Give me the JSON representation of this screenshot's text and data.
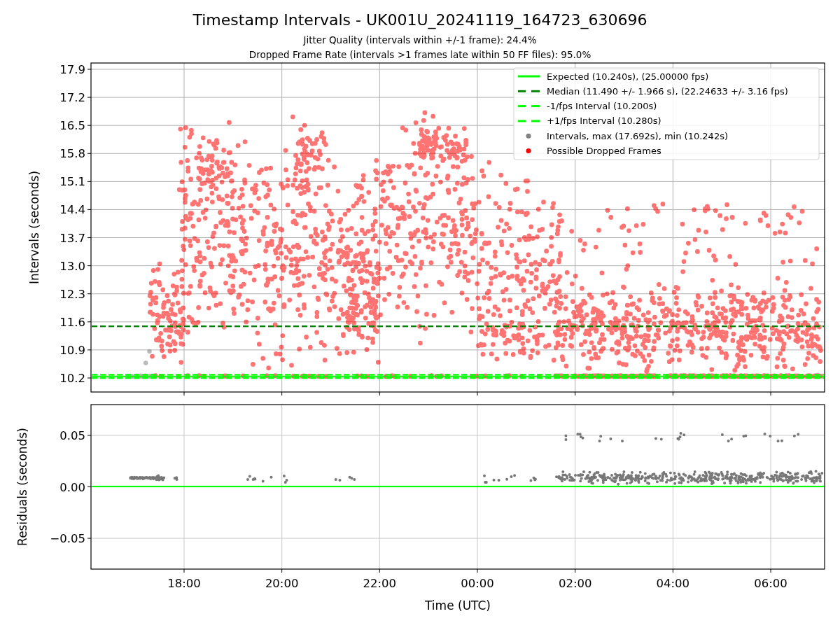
{
  "title": "Timestamp Intervals - UK001U_20241119_164723_630696",
  "subtitles": [
    "Jitter Quality (intervals within +/-1 frame): 24.4%",
    "Dropped Frame Rate (intervals >1 frames late within 50 FF files): 95.0%"
  ],
  "intervals_plot": {
    "y_axis_label": "Intervals (seconds)",
    "y_ticks": [
      "17.9",
      "17.2",
      "16.5",
      "15.8",
      "15.1",
      "14.4",
      "13.7",
      "13.0",
      "12.3",
      "11.6",
      "10.9",
      "10.2"
    ],
    "legend": [
      {
        "label": "Expected (10.240s), (25.00000 fps)",
        "color": "#00ff00",
        "kind": "solid"
      },
      {
        "label": "Median (11.490 +/- 1.966 s), (22.24633 +/- 3.16 fps)",
        "color": "#008000",
        "kind": "dashed"
      },
      {
        "label": "-1/fps Interval (10.200s)",
        "color": "#00ff00",
        "kind": "dashed"
      },
      {
        "label": "+1/fps Interval (10.280s)",
        "color": "#00ff00",
        "kind": "dashed"
      },
      {
        "label": "Intervals, max (17.692s), min (10.242s)",
        "color": "#808080",
        "kind": "marker"
      },
      {
        "label": "Possible Dropped Frames",
        "color": "#ff0000",
        "kind": "marker"
      }
    ]
  },
  "residuals_plot": {
    "y_axis_label": "Residuals (seconds)",
    "y_ticks": [
      "0.05",
      "0.00",
      "−0.05"
    ],
    "x_ticks": [
      "18:00",
      "20:00",
      "22:00",
      "00:00",
      "02:00",
      "04:00",
      "06:00"
    ],
    "x_axis_label": "Time (UTC)"
  }
}
